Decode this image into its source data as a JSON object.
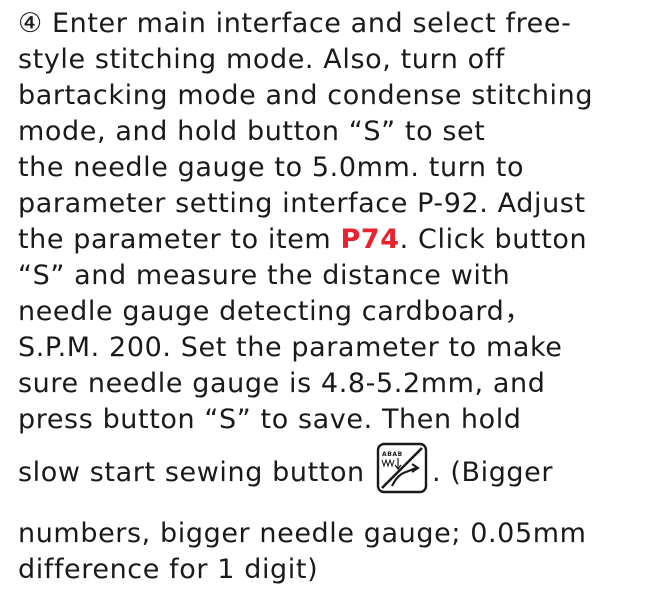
{
  "lines": [
    "④ Enter main interface and select free-",
    "style stitching mode. Also, turn off",
    "bartacking mode and condense stitching",
    "mode, and hold button “S” to set",
    "the needle gauge to 5.0mm. turn to",
    "parameter setting interface P-92. Adjust",
    "the parameter to item ",
    " “S” and measure the distance with",
    "needle gauge detecting cardboard，",
    "S.P.M. 200. Set the parameter to make",
    "sure needle gauge is 4.8-5.2mm, and",
    "press button “S” to save. Then hold",
    "slow start sewing button ",
    ". (Bigger",
    "numbers, bigger needle gauge; 0.05mm",
    "difference for 1 digit)"
  ],
  "param_code": "P74",
  "param_code_suffix": ". Click button",
  "param_code_color": "#e8232f",
  "icon_text": "ABAB",
  "icon": "slow-start-sewing-icon"
}
